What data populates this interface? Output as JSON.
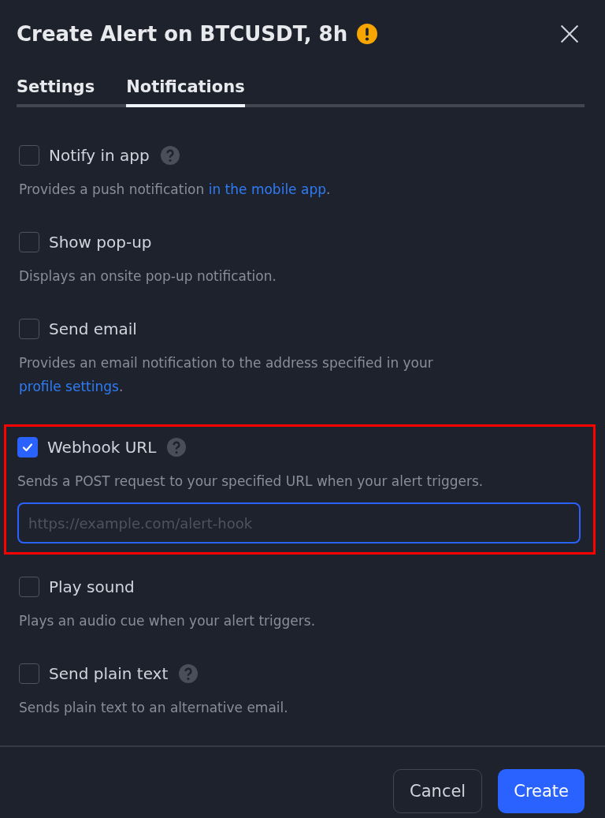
{
  "dialog": {
    "title": "Create Alert on BTCUSDT, 8h",
    "warning": true
  },
  "tabs": [
    {
      "label": "Settings",
      "selected": false
    },
    {
      "label": "Notifications",
      "selected": true
    }
  ],
  "options": [
    {
      "label": "Notify in app",
      "checked": false,
      "help": true,
      "highlighted": false,
      "description": [
        {
          "text": "Provides a push notification ",
          "link": false
        },
        {
          "text": "in the mobile app",
          "link": true
        },
        {
          "text": ".",
          "link": false
        }
      ]
    },
    {
      "label": "Show pop-up",
      "checked": false,
      "help": false,
      "highlighted": false,
      "description": [
        {
          "text": "Displays an onsite pop-up notification.",
          "link": false
        }
      ]
    },
    {
      "label": "Send email",
      "checked": false,
      "help": false,
      "highlighted": false,
      "description": [
        {
          "text": "Provides an email notification to the address specified in your ",
          "link": false
        },
        {
          "text": "profile settings",
          "link": true
        },
        {
          "text": ".",
          "link": false
        }
      ]
    },
    {
      "label": "Webhook URL",
      "checked": true,
      "help": true,
      "highlighted": true,
      "description": [
        {
          "text": "Sends a POST request to your specified URL when your alert triggers.",
          "link": false
        }
      ],
      "field": {
        "placeholder": "https://example.com/alert-hook"
      }
    },
    {
      "label": "Play sound",
      "checked": false,
      "help": false,
      "highlighted": false,
      "description": [
        {
          "text": "Plays an audio cue when your alert triggers.",
          "link": false
        }
      ]
    },
    {
      "label": "Send plain text",
      "checked": false,
      "help": true,
      "highlighted": false,
      "description": [
        {
          "text": "Sends plain text to an alternative email.",
          "link": false
        }
      ]
    }
  ],
  "buttons": [
    {
      "label": "Cancel",
      "kind": "secondary"
    },
    {
      "label": "Create",
      "kind": "primary"
    }
  ]
}
